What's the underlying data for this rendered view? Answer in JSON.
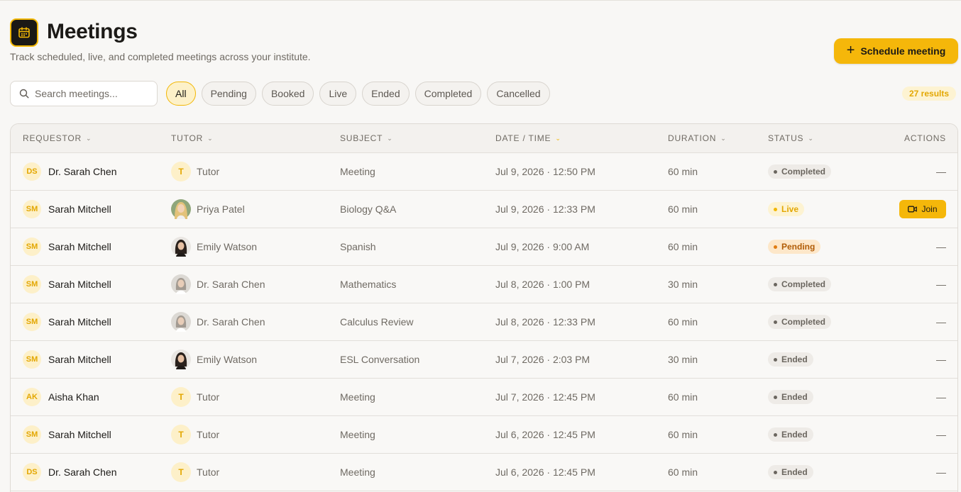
{
  "header": {
    "title": "Meetings",
    "subtitle": "Track scheduled, live, and completed meetings across your institute.",
    "schedule_button": "Schedule meeting",
    "icon": "calendar-icon"
  },
  "search": {
    "placeholder": "Search meetings..."
  },
  "filters": [
    {
      "label": "All",
      "active": true
    },
    {
      "label": "Pending",
      "active": false
    },
    {
      "label": "Booked",
      "active": false
    },
    {
      "label": "Live",
      "active": false
    },
    {
      "label": "Ended",
      "active": false
    },
    {
      "label": "Completed",
      "active": false
    },
    {
      "label": "Cancelled",
      "active": false
    }
  ],
  "results_count": "27 results",
  "columns": [
    "REQUESTOR",
    "TUTOR",
    "SUBJECT",
    "DATE / TIME",
    "DURATION",
    "STATUS",
    "ACTIONS"
  ],
  "sorted_column": "DATE / TIME",
  "colors": {
    "accent": "#f5b70a",
    "background": "#f8f7f5",
    "pending": "#b15c06"
  },
  "rows": [
    {
      "requestor_initials": "DS",
      "requestor": "Dr. Sarah Chen",
      "tutor_avatar": "initial",
      "tutor_initial": "T",
      "tutor": "Tutor",
      "subject": "Meeting",
      "datetime": "Jul 9, 2026 · 12:50 PM",
      "duration": "60 min",
      "status": "Completed",
      "status_key": "completed",
      "action": "—"
    },
    {
      "requestor_initials": "SM",
      "requestor": "Sarah Mitchell",
      "tutor_avatar": "photo-blonde",
      "tutor_initial": "",
      "tutor": "Priya Patel",
      "subject": "Biology Q&A",
      "datetime": "Jul 9, 2026 · 12:33 PM",
      "duration": "60 min",
      "status": "Live",
      "status_key": "live",
      "action": "Join"
    },
    {
      "requestor_initials": "SM",
      "requestor": "Sarah Mitchell",
      "tutor_avatar": "photo-dark",
      "tutor_initial": "",
      "tutor": "Emily Watson",
      "subject": "Spanish",
      "datetime": "Jul 9, 2026 · 9:00 AM",
      "duration": "60 min",
      "status": "Pending",
      "status_key": "pending",
      "action": "—"
    },
    {
      "requestor_initials": "SM",
      "requestor": "Sarah Mitchell",
      "tutor_avatar": "photo-grey",
      "tutor_initial": "",
      "tutor": "Dr. Sarah Chen",
      "subject": "Mathematics",
      "datetime": "Jul 8, 2026 · 1:00 PM",
      "duration": "30 min",
      "status": "Completed",
      "status_key": "completed",
      "action": "—"
    },
    {
      "requestor_initials": "SM",
      "requestor": "Sarah Mitchell",
      "tutor_avatar": "photo-grey",
      "tutor_initial": "",
      "tutor": "Dr. Sarah Chen",
      "subject": "Calculus Review",
      "datetime": "Jul 8, 2026 · 12:33 PM",
      "duration": "60 min",
      "status": "Completed",
      "status_key": "completed",
      "action": "—"
    },
    {
      "requestor_initials": "SM",
      "requestor": "Sarah Mitchell",
      "tutor_avatar": "photo-dark",
      "tutor_initial": "",
      "tutor": "Emily Watson",
      "subject": "ESL Conversation",
      "datetime": "Jul 7, 2026 · 2:03 PM",
      "duration": "30 min",
      "status": "Ended",
      "status_key": "ended",
      "action": "—"
    },
    {
      "requestor_initials": "AK",
      "requestor": "Aisha Khan",
      "tutor_avatar": "initial",
      "tutor_initial": "T",
      "tutor": "Tutor",
      "subject": "Meeting",
      "datetime": "Jul 7, 2026 · 12:45 PM",
      "duration": "60 min",
      "status": "Ended",
      "status_key": "ended",
      "action": "—"
    },
    {
      "requestor_initials": "SM",
      "requestor": "Sarah Mitchell",
      "tutor_avatar": "initial",
      "tutor_initial": "T",
      "tutor": "Tutor",
      "subject": "Meeting",
      "datetime": "Jul 6, 2026 · 12:45 PM",
      "duration": "60 min",
      "status": "Ended",
      "status_key": "ended",
      "action": "—"
    },
    {
      "requestor_initials": "DS",
      "requestor": "Dr. Sarah Chen",
      "tutor_avatar": "initial",
      "tutor_initial": "T",
      "tutor": "Tutor",
      "subject": "Meeting",
      "datetime": "Jul 6, 2026 · 12:45 PM",
      "duration": "60 min",
      "status": "Ended",
      "status_key": "ended",
      "action": "—"
    }
  ]
}
